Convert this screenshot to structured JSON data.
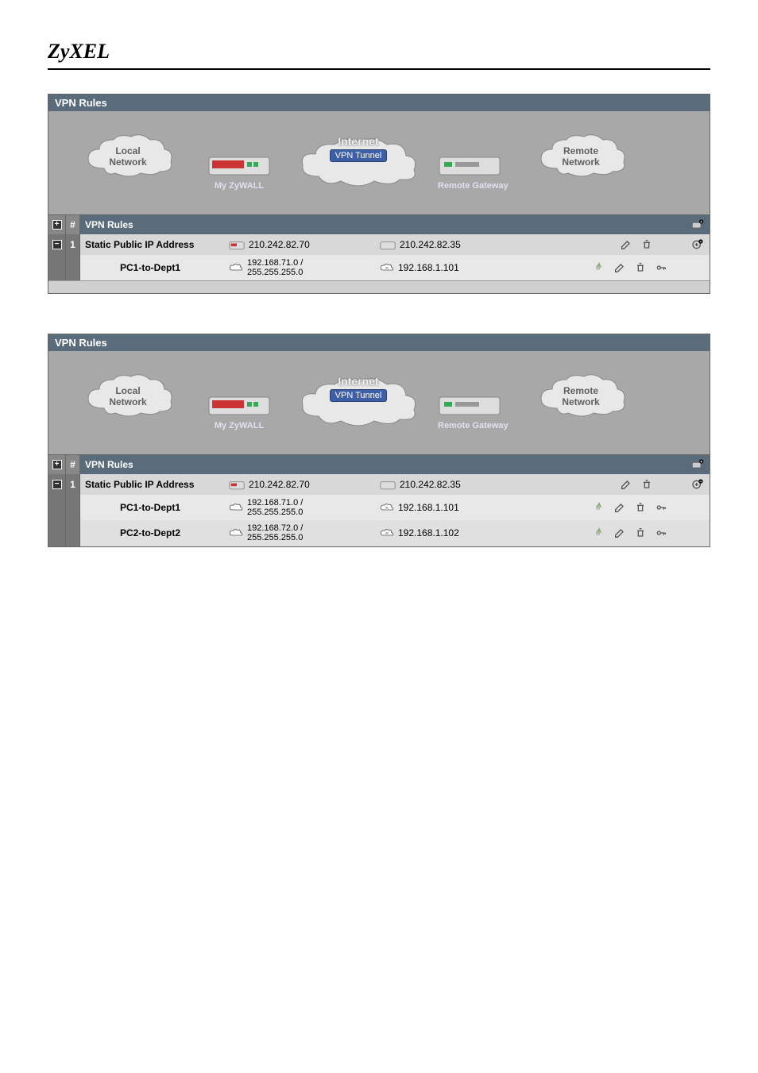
{
  "brand": "ZyXEL",
  "panels": [
    {
      "title": "VPN Rules",
      "diagram": {
        "cloud_left_line1": "Local",
        "cloud_left_line2": "Network",
        "router_left_label": "My ZyWALL",
        "tunnel_label1": "Internet",
        "tunnel_label2": "VPN Tunnel",
        "router_right_label": "Remote Gateway",
        "cloud_right_line1": "Remote",
        "cloud_right_line2": "Network"
      },
      "rules_header": "VPN Rules",
      "header_num": "#",
      "gateway": {
        "num": "1",
        "name": "Static Public IP Address",
        "local_ip": "210.242.82.70",
        "remote_ip": "210.242.82.35"
      },
      "policies": [
        {
          "name": "PC1-to-Dept1",
          "local_line1": "192.168.71.0 /",
          "local_line2": "255.255.255.0",
          "remote": "192.168.1.101"
        }
      ]
    },
    {
      "title": "VPN Rules",
      "diagram": {
        "cloud_left_line1": "Local",
        "cloud_left_line2": "Network",
        "router_left_label": "My ZyWALL",
        "tunnel_label1": "Internet",
        "tunnel_label2": "VPN Tunnel",
        "router_right_label": "Remote Gateway",
        "cloud_right_line1": "Remote",
        "cloud_right_line2": "Network"
      },
      "rules_header": "VPN Rules",
      "header_num": "#",
      "gateway": {
        "num": "1",
        "name": "Static Public IP Address",
        "local_ip": "210.242.82.70",
        "remote_ip": "210.242.82.35"
      },
      "policies": [
        {
          "name": "PC1-to-Dept1",
          "local_line1": "192.168.71.0 /",
          "local_line2": "255.255.255.0",
          "remote": "192.168.1.101"
        },
        {
          "name": "PC2-to-Dept2",
          "local_line1": "192.168.72.0 /",
          "local_line2": "255.255.255.0",
          "remote": "192.168.1.102"
        }
      ]
    }
  ]
}
